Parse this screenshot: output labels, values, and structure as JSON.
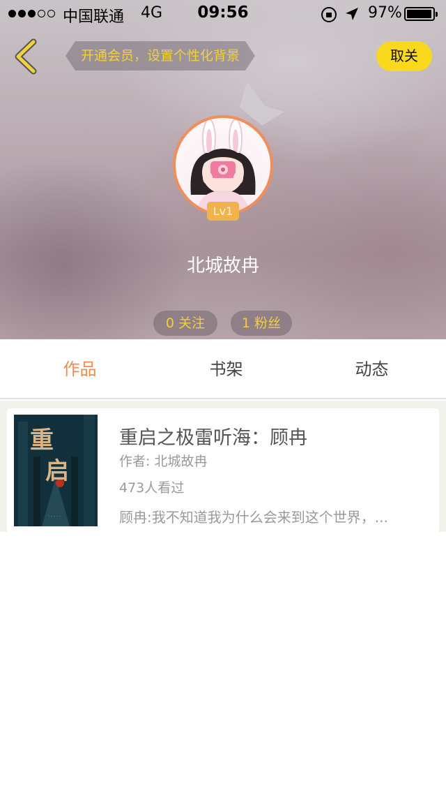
{
  "status_bar": {
    "carrier": "中国联通",
    "network": "4G",
    "time": "09:56",
    "battery": "97%",
    "battery_level": 0.97
  },
  "header": {
    "vip_banner": "开通会员，设置个性化背景",
    "unfollow_label": "取关",
    "level": "Lv1",
    "username": "北城故冉",
    "following": "0 关注",
    "fans": "1 粉丝"
  },
  "tabs": [
    {
      "label": "作品",
      "active": true
    },
    {
      "label": "书架",
      "active": false
    },
    {
      "label": "动态",
      "active": false
    }
  ],
  "book": {
    "title": "重启之极雷听海：顾冉",
    "author": "作者: 北城故冉",
    "views": "473人看过",
    "excerpt": "顾冉:我不知道我为什么会来到这个世界，..."
  },
  "cover": {
    "title_chars": "重启"
  },
  "colors": {
    "accent_orange": "#f08a4f",
    "accent_yellow": "#f9d81d",
    "banner_text": "#f2cf3e"
  },
  "icons": [
    "back-icon",
    "lock-rotation-icon",
    "location-arrow-icon",
    "battery-icon"
  ]
}
